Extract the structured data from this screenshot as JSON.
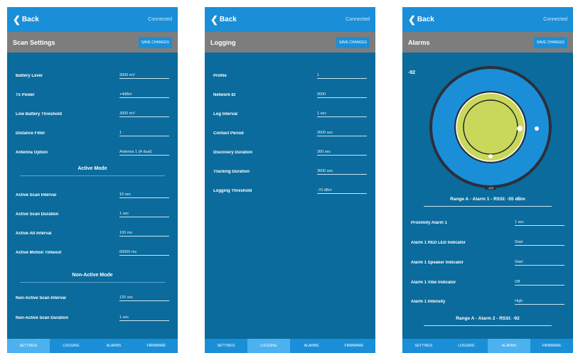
{
  "screens": [
    {
      "back": "Back",
      "status": "Connected",
      "title": "Scan Settings",
      "button": "SAVE CHANGES",
      "rows": [
        {
          "label": "Battery Level",
          "value": "3000 mV"
        },
        {
          "label": "Tx Power",
          "value": "+4dBm"
        },
        {
          "label": "Low Battery Threshold",
          "value": "3000 mV"
        },
        {
          "label": "Distance Filter",
          "value": "1"
        },
        {
          "label": "Antenna Option",
          "value": "Antenna 1 (A dual)"
        }
      ],
      "section1": "Active Mode",
      "rows2": [
        {
          "label": "Active Scan Interval",
          "value": "10 sec"
        },
        {
          "label": "Active Scan Duration",
          "value": "1 sec"
        },
        {
          "label": "Active Alt Interval",
          "value": "100 ms"
        },
        {
          "label": "Active Motion Timeout",
          "value": "60000 ms"
        }
      ],
      "section2": "Non-Active Mode",
      "rows3": [
        {
          "label": "Non-Active Scan Interval",
          "value": "120 sec"
        },
        {
          "label": "Non-Active Scan Duration",
          "value": "1 sec"
        }
      ],
      "tabs": [
        "SETTINGS",
        "LOGGING",
        "ALARMS",
        "FIRMWARE"
      ]
    },
    {
      "back": "Back",
      "status": "Connected",
      "title": "Logging",
      "button": "SAVE CHANGES",
      "rows": [
        {
          "label": "Profile",
          "value": "1"
        },
        {
          "label": "Network ID",
          "value": "0000"
        },
        {
          "label": "Log Interval",
          "value": "1 sec"
        },
        {
          "label": "Contact Period",
          "value": "3600 sec"
        },
        {
          "label": "Discovery Duration",
          "value": "300 sec"
        },
        {
          "label": "Tracking Duration",
          "value": "3600 sec"
        },
        {
          "label": "Logging Threshold",
          "value": "-70 dBm"
        }
      ],
      "tabs": [
        "SETTINGS",
        "LOGGING",
        "ALARMS",
        "FIRMWARE"
      ]
    },
    {
      "back": "Back",
      "status": "Connected",
      "title": "Alarms",
      "button": "SAVE CHANGES",
      "radar_label": "-92",
      "radar_bottom": "-100",
      "range_a": "Range A - Alarm 1 - RSSI: -55 dBm",
      "rows": [
        {
          "label": "Proximity Alarm 1",
          "value": "1 sec"
        },
        {
          "label": "Alarm 1 RED LED Indicator",
          "value": "Start"
        },
        {
          "label": "Alarm 1 Speaker Indicator",
          "value": "Start"
        },
        {
          "label": "Alarm 1 Vibe Indicator",
          "value": "Off"
        },
        {
          "label": "Alarm 1 Intensity",
          "value": "High"
        }
      ],
      "range_b": "Range A - Alarm 2 - RSSI: -92",
      "tabs": [
        "SETTINGS",
        "LOGGING",
        "ALARMS",
        "FIRMWARE"
      ]
    }
  ],
  "colors": {
    "background": "#0a6b9c",
    "bar": "#1a8fd8",
    "titlebar": "#7d7d7d",
    "active_tab": "#4cb1ef",
    "ring_fill": "#c9d85a"
  }
}
